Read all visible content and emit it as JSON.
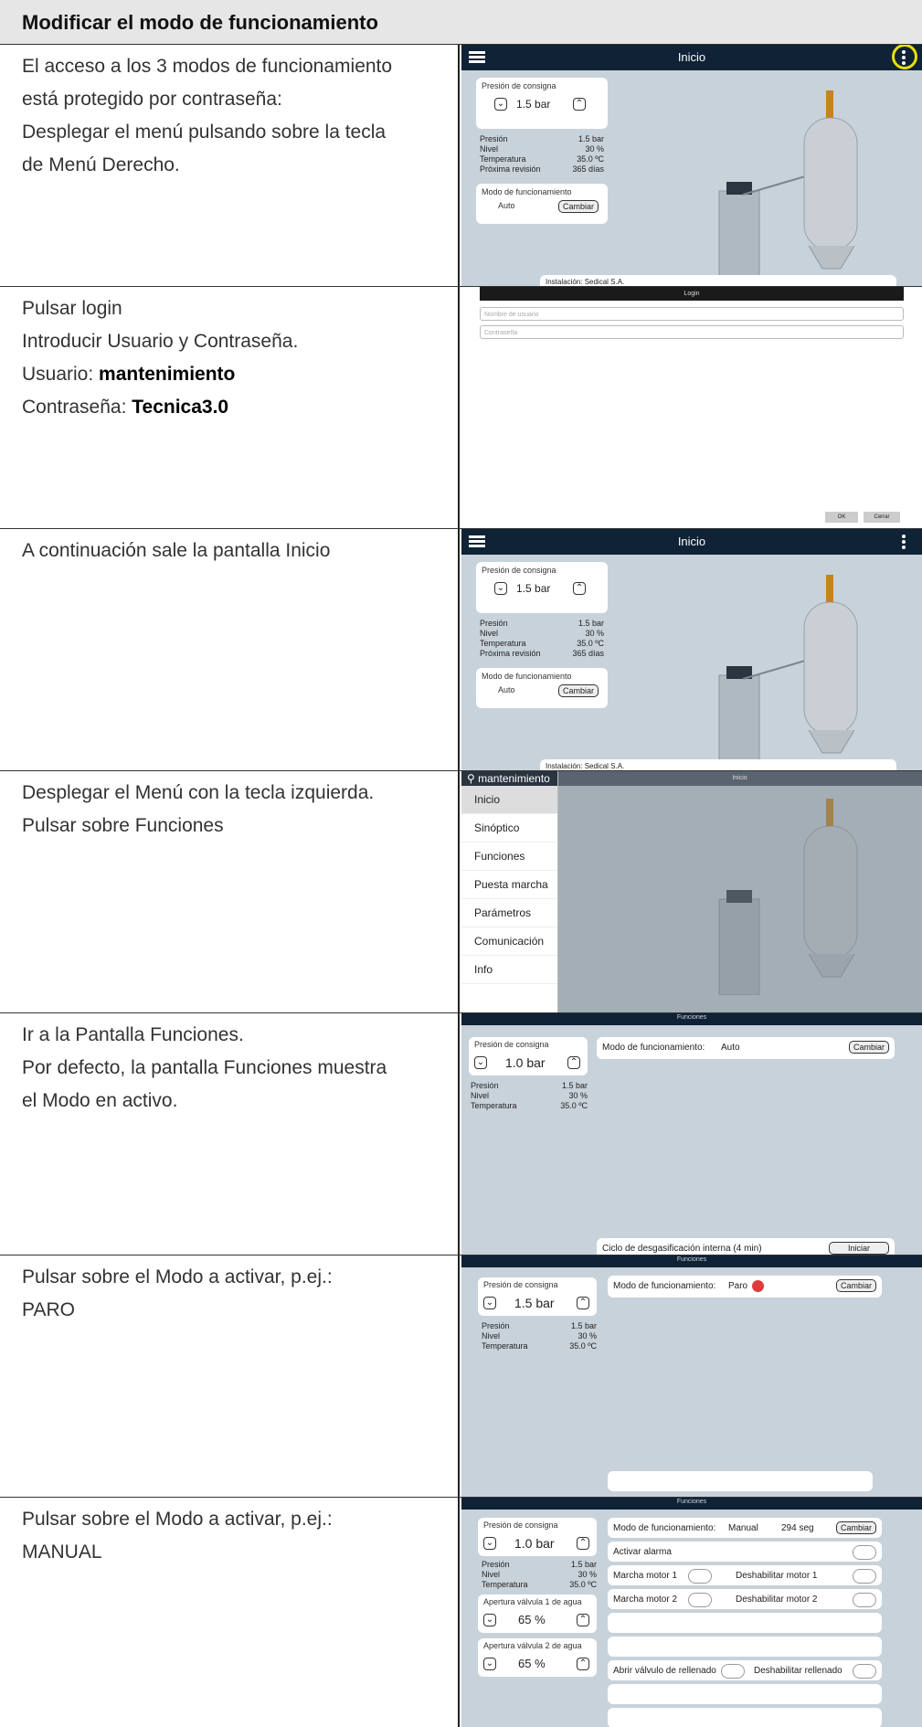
{
  "header": {
    "title": "Modificar el modo de funcionamiento"
  },
  "rows": [
    {
      "lines": [
        "El acceso a los 3 modos de funcionamiento",
        "está protegido por contraseña:",
        "Desplegar el menú pulsando sobre la tecla",
        "de Menú Derecho."
      ]
    },
    {
      "lines": [
        "Pulsar login",
        "Introducir Usuario y Contraseña."
      ],
      "user_label": "Usuario: ",
      "user_value": "mantenimiento",
      "pass_label": "Contraseña: ",
      "pass_value": "Tecnica3.0"
    },
    {
      "lines": [
        "A continuación sale la pantalla Inicio"
      ]
    },
    {
      "lines": [
        "Desplegar el Menú con la tecla izquierda.",
        "Pulsar sobre Funciones"
      ]
    },
    {
      "lines": [
        "Ir a la Pantalla Funciones.",
        "Por defecto, la pantalla Funciones muestra",
        "el Modo en activo."
      ]
    },
    {
      "lines": [
        "Pulsar sobre el Modo a activar, p.ej.:",
        "PARO"
      ]
    },
    {
      "lines": [
        "Pulsar sobre el Modo a activar, p.ej.:",
        "MANUAL"
      ]
    }
  ],
  "inicio": {
    "title": "Inicio",
    "setpoint_label": "Presión de consigna",
    "setpoint_value": "1.5 bar",
    "presion_l": "Presión",
    "presion_v": "1.5 bar",
    "nivel_l": "Nivel",
    "nivel_v": "30 %",
    "temp_l": "Temperatura",
    "temp_v": "35.0 ºC",
    "rev_l": "Próxima revisión",
    "rev_v": "365 días",
    "mode_label": "Modo de funcionamiento",
    "mode_value": "Auto",
    "change": "Cambiar",
    "install": "Instalación: Sedical S.A."
  },
  "login": {
    "title": "Login",
    "user_ph": "Nombre de usuario",
    "pass_ph": "Contraseña",
    "ok": "OK",
    "cancel": "Cerrar"
  },
  "menu": {
    "user": "mantenimiento",
    "title": "Inicio",
    "items": [
      "Inicio",
      "Sinóptico",
      "Funciones",
      "Puesta marcha",
      "Parámetros",
      "Comunicación",
      "Info"
    ]
  },
  "funciones": {
    "title": "Funciones",
    "setpoint_label": "Presión de consigna",
    "setpoint_a": "1.0 bar",
    "setpoint_b": "1.5 bar",
    "mode_label": "Modo de funcionamiento:",
    "mode_auto": "Auto",
    "mode_paro": "Paro",
    "mode_manual": "Manual",
    "seconds": "294 seg",
    "change": "Cambiar",
    "cycle": "Ciclo de desgasificación interna   (4 min)",
    "start": "Iniciar",
    "alarm": "Activar alarma",
    "m1": "Marcha motor 1",
    "d1": "Deshabilitar motor 1",
    "m2": "Marcha motor 2",
    "d2": "Deshabilitar motor 2",
    "valve1": "Apertura válvula 1 de agua",
    "valve2": "Apertura válvula 2 de agua",
    "valve_v": "65 %",
    "refill": "Abrir válvulo de rellenado",
    "refill_dis": "Deshabilitar rellenado"
  }
}
